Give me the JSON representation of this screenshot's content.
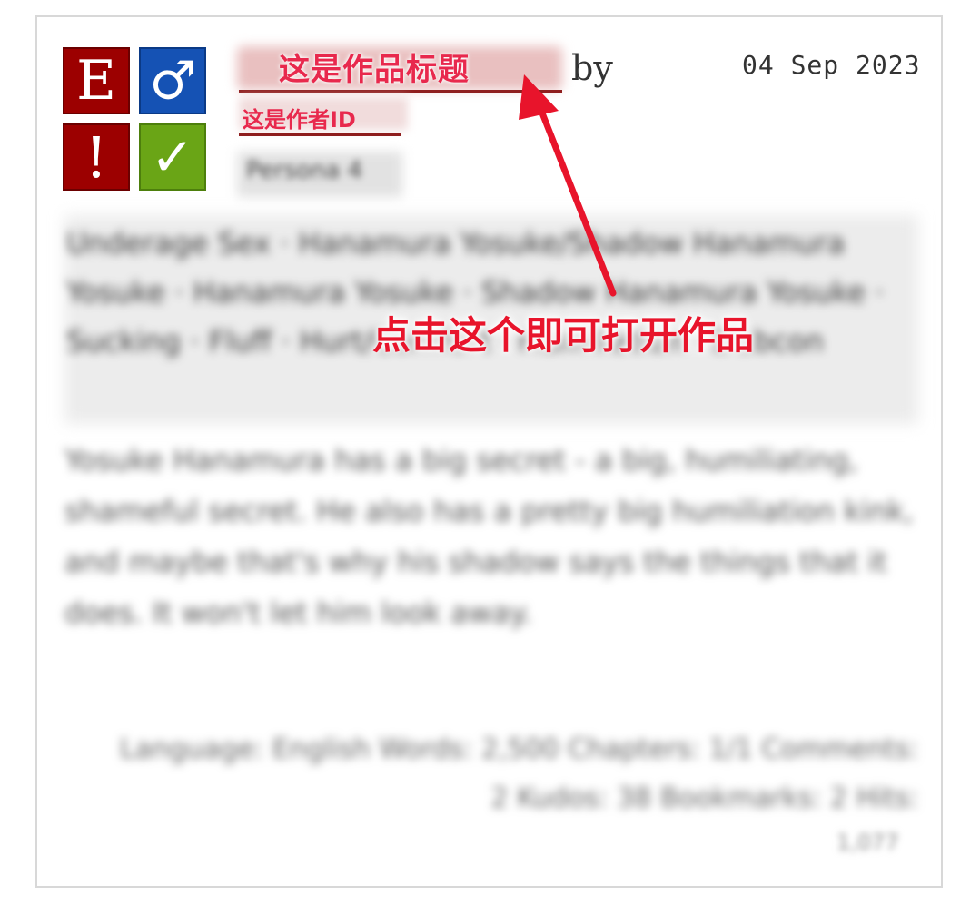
{
  "work": {
    "title_annotation": "这是作品标题",
    "by_label": "by",
    "author_annotation": "这是作者ID",
    "date": "04 Sep 2023",
    "fandom": "Persona 4",
    "tags": "Underage Sex · Hanamura Yosuke/Shadow Hanamura Yosuke · Hanamura Yosuke · Shadow Hanamura Yosuke · Sucking · Fluff · Hurt/Comfort · Humiliation · Dubcon",
    "summary": "Yosuke Hanamura has a big secret - a big, humiliating, shameful secret. He also has a pretty big humiliation kink, and maybe that's why his shadow says the things that it does. It won't let him look away.",
    "stats": "Language: English   Words: 2,500   Chapters: 1/1   Comments: 2   Kudos: 38   Bookmarks: 2   Hits:",
    "hits": "1,077"
  },
  "badges": {
    "rating": "E",
    "category": "♂",
    "warning": "!",
    "complete": "✓"
  },
  "annotation": {
    "callout": "点击这个即可打开作品",
    "arrow_color": "#e8142b"
  }
}
